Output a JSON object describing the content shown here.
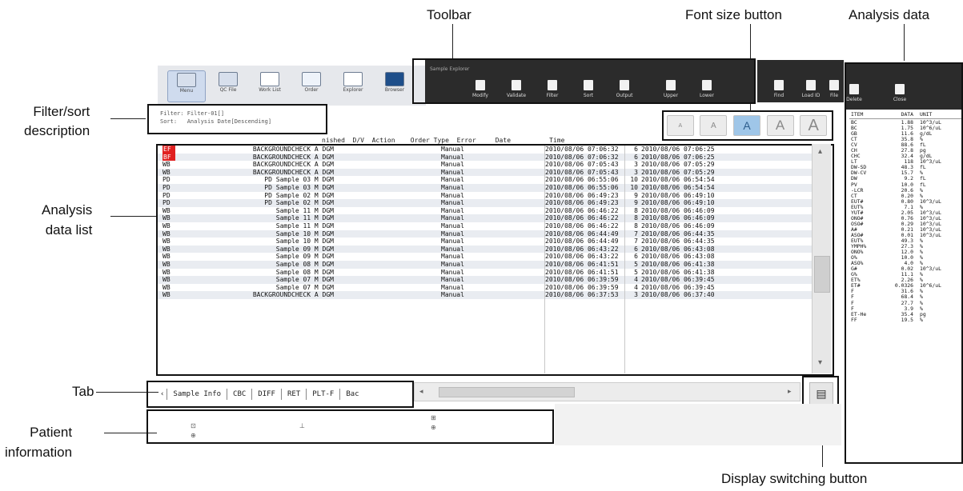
{
  "callouts": {
    "toolbar": "Toolbar",
    "font_size_button": "Font size button",
    "analysis_data": "Analysis data",
    "filter_sort_line1": "Filter/sort",
    "filter_sort_line2": "description",
    "analysis_data_list_line1": "Analysis",
    "analysis_data_list_line2": "data list",
    "tab": "Tab",
    "patient_information_line1": "Patient",
    "patient_information_line2": "information",
    "display_switching_button": "Display switching button"
  },
  "primary_toolbar": {
    "buttons": [
      "Menu",
      "QC File",
      "Work List",
      "Order",
      "Explorer",
      "Browser"
    ]
  },
  "explorer_toolbar": {
    "title": "Sample Explorer",
    "buttons": [
      "Modify",
      "Validate",
      "Filter",
      "Sort",
      "Output",
      "Upper",
      "Lower"
    ]
  },
  "right_toolbar": {
    "buttons": [
      "Find",
      "Load ID",
      "File",
      "Delete",
      "Close"
    ]
  },
  "filter": {
    "line1": "Filter: Filter-01[]",
    "line2": "Sort:   Analysis Date[Descending]"
  },
  "font_size_buttons": [
    "A",
    "A",
    "A",
    "A",
    "A"
  ],
  "list_header": "nished  D/V  Action    Order Type  Error     Date          Time",
  "rows": [
    {
      "id": "EF",
      "sample": "BACKGROUNDCHECK A DGM",
      "order": "Manual",
      "date": "2010/08/06 07:06:32",
      "rn": "6",
      "stamp": "2010/08/06 07:06:25",
      "red": true
    },
    {
      "id": "BF",
      "sample": "BACKGROUNDCHECK A DGM",
      "order": "Manual",
      "date": "2010/08/06 07:06:32",
      "rn": "6",
      "stamp": "2010/08/06 07:06:25",
      "red": true
    },
    {
      "id": "WB",
      "sample": "BACKGROUNDCHECK A DGM",
      "order": "Manual",
      "date": "2010/08/06 07:05:43",
      "rn": "3",
      "stamp": "2010/08/06 07:05:29",
      "red": false
    },
    {
      "id": "WB",
      "sample": "BACKGROUNDCHECK A DGM",
      "order": "Manual",
      "date": "2010/08/06 07:05:43",
      "rn": "3",
      "stamp": "2010/08/06 07:05:29",
      "red": false
    },
    {
      "id": "PD",
      "sample": "PD Sample 03 M DGM",
      "order": "Manual",
      "date": "2010/08/06 06:55:06",
      "rn": "10",
      "stamp": "2010/08/06 06:54:54",
      "red": false
    },
    {
      "id": "PD",
      "sample": "PD Sample 03 M DGM",
      "order": "Manual",
      "date": "2010/08/06 06:55:06",
      "rn": "10",
      "stamp": "2010/08/06 06:54:54",
      "red": false
    },
    {
      "id": "PD",
      "sample": "PD Sample 02 M DGM",
      "order": "Manual",
      "date": "2010/08/06 06:49:23",
      "rn": "9",
      "stamp": "2010/08/06 06:49:10",
      "red": false
    },
    {
      "id": "PD",
      "sample": "PD Sample 02 M DGM",
      "order": "Manual",
      "date": "2010/08/06 06:49:23",
      "rn": "9",
      "stamp": "2010/08/06 06:49:10",
      "red": false
    },
    {
      "id": "WB",
      "sample": "Sample 11 M DGM",
      "order": "Manual",
      "date": "2010/08/06 06:46:22",
      "rn": "8",
      "stamp": "2010/08/06 06:46:09",
      "red": false
    },
    {
      "id": "WB",
      "sample": "Sample 11 M DGM",
      "order": "Manual",
      "date": "2010/08/06 06:46:22",
      "rn": "8",
      "stamp": "2010/08/06 06:46:09",
      "red": false
    },
    {
      "id": "WB",
      "sample": "Sample 11 M DGM",
      "order": "Manual",
      "date": "2010/08/06 06:46:22",
      "rn": "8",
      "stamp": "2010/08/06 06:46:09",
      "red": false
    },
    {
      "id": "WB",
      "sample": "Sample 10 M DGM",
      "order": "Manual",
      "date": "2010/08/06 06:44:49",
      "rn": "7",
      "stamp": "2010/08/06 06:44:35",
      "red": false
    },
    {
      "id": "WB",
      "sample": "Sample 10 M DGM",
      "order": "Manual",
      "date": "2010/08/06 06:44:49",
      "rn": "7",
      "stamp": "2010/08/06 06:44:35",
      "red": false
    },
    {
      "id": "WB",
      "sample": "Sample 09 M DGM",
      "order": "Manual",
      "date": "2010/08/06 06:43:22",
      "rn": "6",
      "stamp": "2010/08/06 06:43:08",
      "red": false
    },
    {
      "id": "WB",
      "sample": "Sample 09 M DGM",
      "order": "Manual",
      "date": "2010/08/06 06:43:22",
      "rn": "6",
      "stamp": "2010/08/06 06:43:08",
      "red": false
    },
    {
      "id": "WB",
      "sample": "Sample 08 M DGM",
      "order": "Manual",
      "date": "2010/08/06 06:41:51",
      "rn": "5",
      "stamp": "2010/08/06 06:41:38",
      "red": false
    },
    {
      "id": "WB",
      "sample": "Sample 08 M DGM",
      "order": "Manual",
      "date": "2010/08/06 06:41:51",
      "rn": "5",
      "stamp": "2010/08/06 06:41:38",
      "red": false
    },
    {
      "id": "WB",
      "sample": "Sample 07 M DGM",
      "order": "Manual",
      "date": "2010/08/06 06:39:59",
      "rn": "4",
      "stamp": "2010/08/06 06:39:45",
      "red": false
    },
    {
      "id": "WB",
      "sample": "Sample 07 M DGM",
      "order": "Manual",
      "date": "2010/08/06 06:39:59",
      "rn": "4",
      "stamp": "2010/08/06 06:39:45",
      "red": false
    },
    {
      "id": "WB",
      "sample": "BACKGROUNDCHECK A DGM",
      "order": "Manual",
      "date": "2010/08/06 06:37:53",
      "rn": "3",
      "stamp": "2010/08/06 06:37:40",
      "red": false
    }
  ],
  "tabs": [
    "Sample Info",
    "CBC",
    "DIFF",
    "RET",
    "PLT-F",
    "Bac"
  ],
  "tab_left_arrow": "‹",
  "patient": {
    "mark1": "⊡",
    "mark2": "⊥",
    "mark3": "⊞",
    "mark4": "⊕",
    "mark5": "⊕"
  },
  "analysis_table": {
    "headers": [
      "ITEM",
      "DATA",
      "UNIT"
    ],
    "rows": [
      [
        "BC",
        "1.88",
        "10^3/uL"
      ],
      [
        "BC",
        "1.75",
        "10^6/uL"
      ],
      [
        "GB",
        "11.6",
        "g/dL"
      ],
      [
        "CT",
        "35.8",
        "%"
      ],
      [
        "CV",
        "88.6",
        "fL"
      ],
      [
        "CH",
        "27.8",
        "pg"
      ],
      [
        "CHC",
        "32.4",
        "g/dL"
      ],
      [
        "LT",
        "118",
        "10^3/uL"
      ],
      [
        "DW-SD",
        "48.3",
        "fL"
      ],
      [
        "DW-CV",
        "15.7",
        "%"
      ],
      [
        "DW",
        "9.2",
        "fL"
      ],
      [
        "PV",
        "10.0",
        "fL"
      ],
      [
        "-LCR",
        "20.6",
        "%"
      ],
      [
        "CT",
        "0.20",
        "%"
      ],
      [
        "EUT#",
        "0.80",
        "10^3/uL"
      ],
      [
        "EUT%",
        "7.1",
        "%"
      ],
      [
        "YUT#",
        "2.05",
        "10^3/uL"
      ],
      [
        "ONO#",
        "0.76",
        "10^3/uL"
      ],
      [
        "OSO#",
        "0.29",
        "10^3/uL"
      ],
      [
        "A#",
        "0.21",
        "10^3/uL"
      ],
      [
        "ASO#",
        "0.01",
        "10^3/uL"
      ],
      [
        "EUT%",
        "49.3",
        "%"
      ],
      [
        "YMPH%",
        "27.3",
        "%"
      ],
      [
        "ONO%",
        "12.0",
        "%"
      ],
      [
        "O%",
        "10.0",
        "%"
      ],
      [
        "ASO%",
        "4.0",
        "%"
      ],
      [
        "G#",
        "0.02",
        "10^3/uL"
      ],
      [
        "G%",
        "11.1",
        "%"
      ],
      [
        "ET%",
        "2.26",
        "%"
      ],
      [
        "ET#",
        "0.0326",
        "10^6/uL"
      ],
      [
        "F",
        "31.6",
        "%"
      ],
      [
        "F",
        "68.4",
        "%"
      ],
      [
        "F",
        "27.7",
        "%"
      ],
      [
        "F",
        "3.9",
        "%"
      ],
      [
        "ET-He",
        "35.4",
        "pg"
      ],
      [
        "FF",
        "19.5",
        "%"
      ]
    ]
  },
  "switch_icon": "▤"
}
